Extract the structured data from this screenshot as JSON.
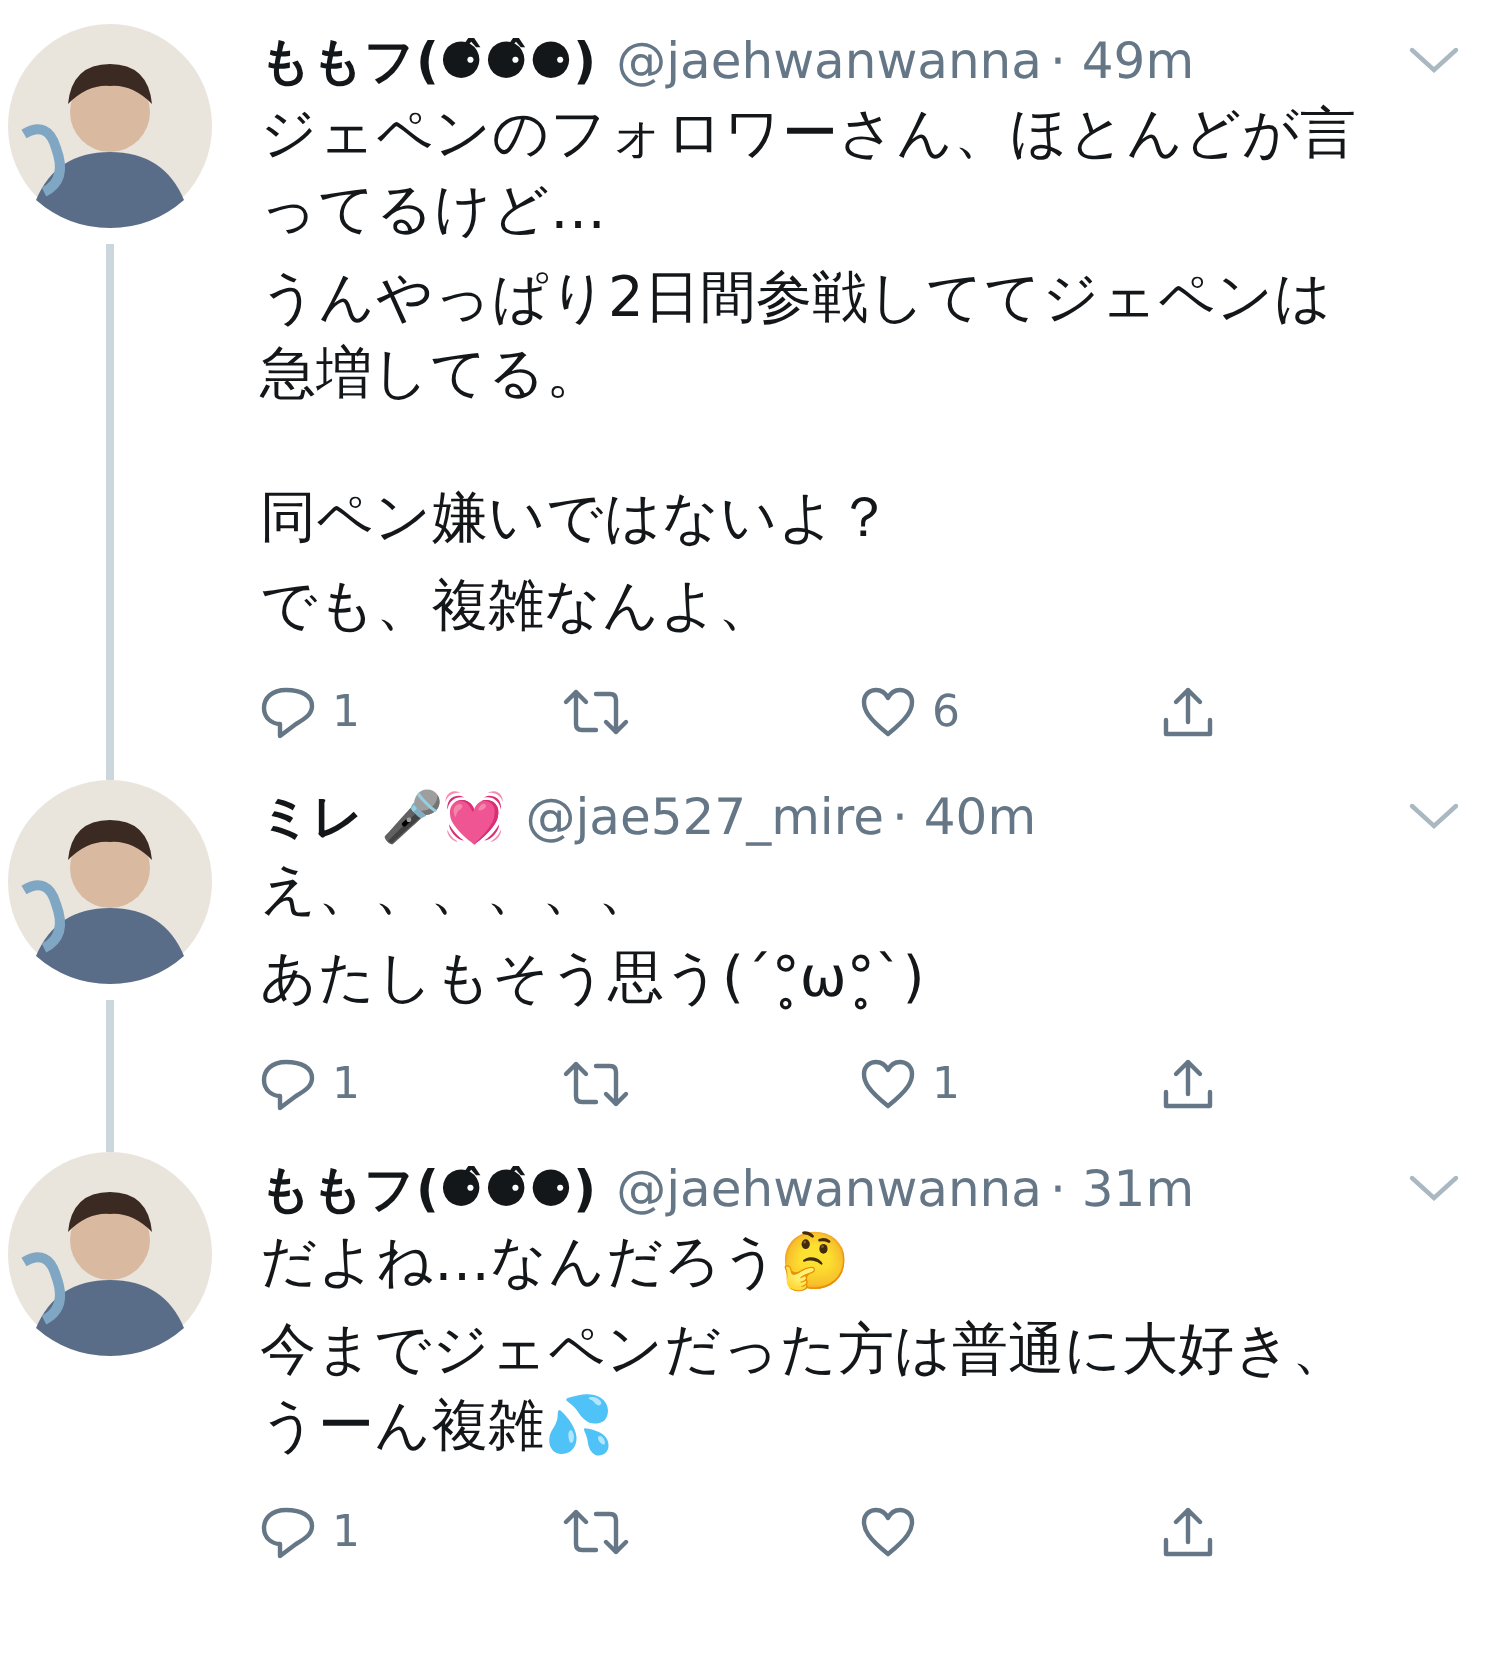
{
  "tweets": [
    {
      "name": "ももフ(⚈̂⚈̂⚈)",
      "handle": "@jaehwanwanna",
      "time": "· 49m",
      "thread_line": true,
      "paragraphs": [
        [
          "ジェペンのフォロワーさん、ほとんどが言ってるけど…",
          "うんやっぱり2日間参戦しててジェペンは急増してる。"
        ],
        [
          "同ペン嫌いではないよ？",
          "でも、複雑なんよ、"
        ]
      ],
      "replies": "1",
      "likes": "6"
    },
    {
      "name": "ミレ 🎤💓",
      "handle": "@jae527_mire",
      "time": "· 40m",
      "thread_line": true,
      "paragraphs": [
        [
          "え、、、、、、",
          "あたしもそう思う(´°̥ω°̥`)"
        ]
      ],
      "replies": "1",
      "likes": "1"
    },
    {
      "name": "ももフ(⚈̂⚈̂⚈)",
      "handle": "@jaehwanwanna",
      "time": "· 31m",
      "paragraphs": [
        [
          "だよね…なんだろう🤔",
          "今までジェペンだった方は普通に大好き、うーん複雑💦"
        ]
      ],
      "replies": "1"
    }
  ]
}
